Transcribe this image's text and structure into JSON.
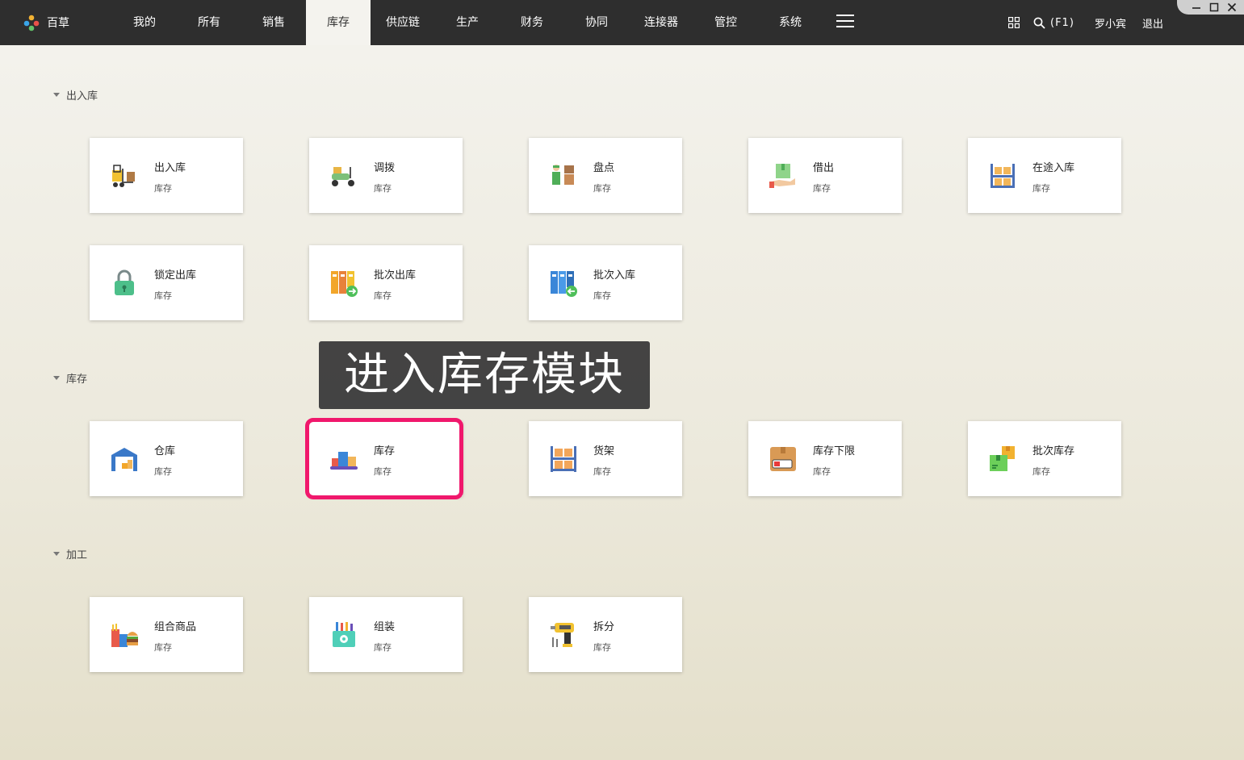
{
  "app": {
    "name": "百草"
  },
  "nav": {
    "tabs": [
      "我的",
      "所有",
      "销售",
      "库存",
      "供应链",
      "生产",
      "财务",
      "协同",
      "连接器",
      "管控",
      "系统"
    ],
    "active": "库存"
  },
  "header": {
    "search_label": "(F1)",
    "user": "罗小宾",
    "logout": "退出"
  },
  "sections": [
    {
      "title": "出入库",
      "cards": [
        {
          "title": "出入库",
          "sub": "库存",
          "icon": "forklift-icon"
        },
        {
          "title": "调拨",
          "sub": "库存",
          "icon": "scooter-icon"
        },
        {
          "title": "盘点",
          "sub": "库存",
          "icon": "worker-boxes-icon"
        },
        {
          "title": "借出",
          "sub": "库存",
          "icon": "hand-box-icon"
        },
        {
          "title": "在途入库",
          "sub": "库存",
          "icon": "shelf-boxes-icon"
        },
        {
          "title": "锁定出库",
          "sub": "库存",
          "icon": "lock-icon"
        },
        {
          "title": "批次出库",
          "sub": "库存",
          "icon": "batch-out-icon"
        },
        {
          "title": "批次入库",
          "sub": "库存",
          "icon": "batch-in-icon"
        }
      ]
    },
    {
      "title": "库存",
      "cards": [
        {
          "title": "仓库",
          "sub": "库存",
          "icon": "warehouse-icon"
        },
        {
          "title": "库存",
          "sub": "库存",
          "icon": "stock-boxes-icon"
        },
        {
          "title": "货架",
          "sub": "库存",
          "icon": "rack-icon"
        },
        {
          "title": "库存下限",
          "sub": "库存",
          "icon": "low-stock-icon"
        },
        {
          "title": "批次库存",
          "sub": "库存",
          "icon": "batch-stock-icon"
        }
      ]
    },
    {
      "title": "加工",
      "cards": [
        {
          "title": "组合商品",
          "sub": "库存",
          "icon": "combo-food-icon"
        },
        {
          "title": "组装",
          "sub": "库存",
          "icon": "assembly-kit-icon"
        },
        {
          "title": "拆分",
          "sub": "库存",
          "icon": "drill-icon"
        }
      ]
    }
  ],
  "annotation": {
    "text": "进入库存模块"
  },
  "colors": {
    "topbar": "#2e2e2e",
    "highlight": "#f0186c",
    "active_tab_bg": "#f4f3ee"
  }
}
